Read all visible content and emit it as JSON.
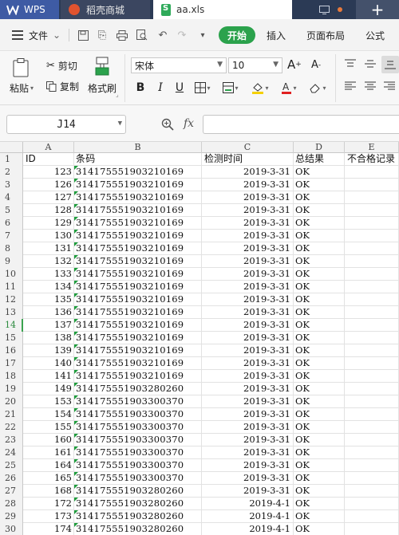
{
  "tabs": {
    "wps": "WPS",
    "daoke": "稻壳商城",
    "file": "aa.xls",
    "add": "+"
  },
  "menu": {
    "file": "文件",
    "start": "开始",
    "insert": "插入",
    "page_layout": "页面布局",
    "formula": "公式"
  },
  "ribbon": {
    "paste": "粘贴",
    "cut": "剪切",
    "copy": "复制",
    "format_painter": "格式刷",
    "font_name": "宋体",
    "font_size": "10",
    "bold": "B",
    "italic": "I",
    "underline": "U"
  },
  "formula_bar": {
    "cell_ref": "J14",
    "fx": "fx",
    "formula": ""
  },
  "columns": [
    "A",
    "B",
    "C",
    "D",
    "E"
  ],
  "header_row": {
    "A": "ID",
    "B": "条码",
    "C": "检测时间",
    "D": "总结果",
    "E": "不合格记录"
  },
  "selected_row": 14,
  "rows": [
    {
      "n": 2,
      "A": "123",
      "B": "314175551903210169",
      "C": "2019-3-31",
      "D": "OK"
    },
    {
      "n": 3,
      "A": "126",
      "B": "314175551903210169",
      "C": "2019-3-31",
      "D": "OK"
    },
    {
      "n": 4,
      "A": "127",
      "B": "314175551903210169",
      "C": "2019-3-31",
      "D": "OK"
    },
    {
      "n": 5,
      "A": "128",
      "B": "314175551903210169",
      "C": "2019-3-31",
      "D": "OK"
    },
    {
      "n": 6,
      "A": "129",
      "B": "314175551903210169",
      "C": "2019-3-31",
      "D": "OK"
    },
    {
      "n": 7,
      "A": "130",
      "B": "314175551903210169",
      "C": "2019-3-31",
      "D": "OK"
    },
    {
      "n": 8,
      "A": "131",
      "B": "314175551903210169",
      "C": "2019-3-31",
      "D": "OK"
    },
    {
      "n": 9,
      "A": "132",
      "B": "314175551903210169",
      "C": "2019-3-31",
      "D": "OK"
    },
    {
      "n": 10,
      "A": "133",
      "B": "314175551903210169",
      "C": "2019-3-31",
      "D": "OK"
    },
    {
      "n": 11,
      "A": "134",
      "B": "314175551903210169",
      "C": "2019-3-31",
      "D": "OK"
    },
    {
      "n": 12,
      "A": "135",
      "B": "314175551903210169",
      "C": "2019-3-31",
      "D": "OK"
    },
    {
      "n": 13,
      "A": "136",
      "B": "314175551903210169",
      "C": "2019-3-31",
      "D": "OK"
    },
    {
      "n": 14,
      "A": "137",
      "B": "314175551903210169",
      "C": "2019-3-31",
      "D": "OK"
    },
    {
      "n": 15,
      "A": "138",
      "B": "314175551903210169",
      "C": "2019-3-31",
      "D": "OK"
    },
    {
      "n": 16,
      "A": "139",
      "B": "314175551903210169",
      "C": "2019-3-31",
      "D": "OK"
    },
    {
      "n": 17,
      "A": "140",
      "B": "314175551903210169",
      "C": "2019-3-31",
      "D": "OK"
    },
    {
      "n": 18,
      "A": "141",
      "B": "314175551903210169",
      "C": "2019-3-31",
      "D": "OK"
    },
    {
      "n": 19,
      "A": "149",
      "B": "314175551903280260",
      "C": "2019-3-31",
      "D": "OK"
    },
    {
      "n": 20,
      "A": "153",
      "B": "314175551903300370",
      "C": "2019-3-31",
      "D": "OK"
    },
    {
      "n": 21,
      "A": "154",
      "B": "314175551903300370",
      "C": "2019-3-31",
      "D": "OK"
    },
    {
      "n": 22,
      "A": "155",
      "B": "314175551903300370",
      "C": "2019-3-31",
      "D": "OK"
    },
    {
      "n": 23,
      "A": "160",
      "B": "314175551903300370",
      "C": "2019-3-31",
      "D": "OK"
    },
    {
      "n": 24,
      "A": "161",
      "B": "314175551903300370",
      "C": "2019-3-31",
      "D": "OK"
    },
    {
      "n": 25,
      "A": "164",
      "B": "314175551903300370",
      "C": "2019-3-31",
      "D": "OK"
    },
    {
      "n": 26,
      "A": "165",
      "B": "314175551903300370",
      "C": "2019-3-31",
      "D": "OK"
    },
    {
      "n": 27,
      "A": "168",
      "B": "314175551903280260",
      "C": "2019-3-31",
      "D": "OK"
    },
    {
      "n": 28,
      "A": "172",
      "B": "314175551903280260",
      "C": "2019-4-1",
      "D": "OK"
    },
    {
      "n": 29,
      "A": "173",
      "B": "314175551903280260",
      "C": "2019-4-1",
      "D": "OK"
    },
    {
      "n": 30,
      "A": "174",
      "B": "314175551903280260",
      "C": "2019-4-1",
      "D": "OK"
    }
  ],
  "colors": {
    "accent_green": "#2ba24c",
    "titlebar": "#2b3a55",
    "text_marker_green": "#1e9c3c"
  }
}
